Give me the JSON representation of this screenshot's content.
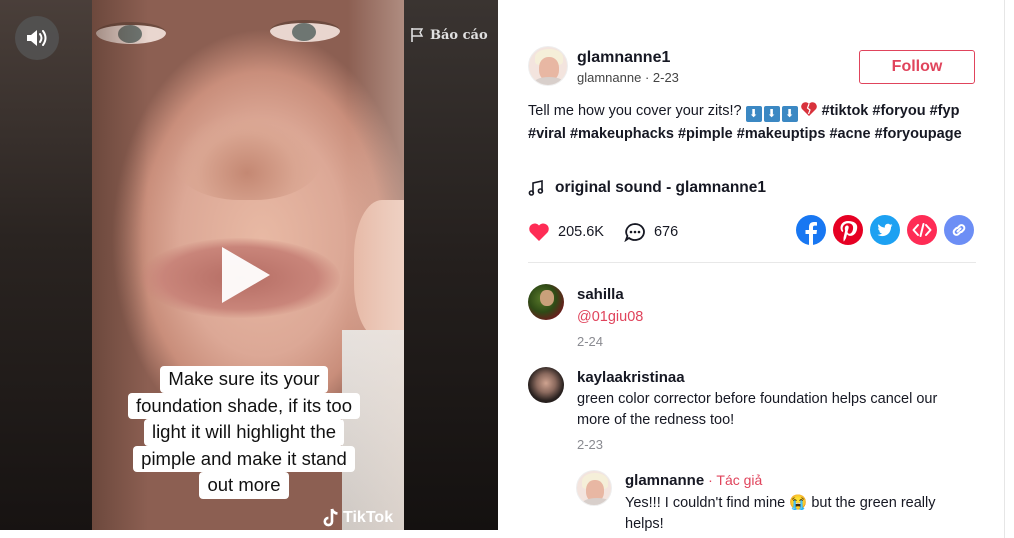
{
  "video": {
    "caption_lines": [
      "Make sure its your",
      "foundation shade, if its too",
      "light it will highlight the",
      "pimple and make it stand",
      "out more"
    ],
    "report_label": "Báo cáo",
    "watermark": "TikTok",
    "icons": {
      "sound": "speaker-icon",
      "report": "flag-icon",
      "play": "play-icon",
      "watermark": "tiktok-logo-icon"
    }
  },
  "author": {
    "username": "glamnanne1",
    "nickname": "glamnanne",
    "separator": " · ",
    "date": "2-23",
    "follow_label": "Follow"
  },
  "description": {
    "text": "Tell me how you cover your zits!? ",
    "emojis": [
      "⬇",
      "⬇",
      "⬇"
    ],
    "hashtags": [
      "#tiktok",
      "#foryou",
      "#fyp",
      "#viral",
      "#makeuphacks",
      "#pimple",
      "#makeuptips",
      "#acne",
      "#foryoupage"
    ]
  },
  "sound": {
    "label": "original sound - glamnanne1"
  },
  "stats": {
    "likes": "205.6K",
    "comments": "676"
  },
  "share": {
    "items": [
      {
        "name": "facebook-share-icon",
        "color": "#1877f2"
      },
      {
        "name": "pinterest-share-icon",
        "color": "#e60023"
      },
      {
        "name": "twitter-share-icon",
        "color": "#1da1f2"
      },
      {
        "name": "embed-share-icon",
        "color": "#fe2c55"
      },
      {
        "name": "copy-link-icon",
        "color": "#6c8ef5"
      }
    ]
  },
  "comments": [
    {
      "username": "sahilla",
      "text": "@01giu08",
      "date": "2-24"
    },
    {
      "username": "kaylaakristinaa",
      "text": "green color corrector before foundation helps cancel our more of the redness too!",
      "date": "2-23"
    }
  ],
  "reply": {
    "username": "glamnanne",
    "separator": " · ",
    "author_tag": "Tác giả",
    "text_before": "Yes!!! I couldn't find mine ",
    "emoji": "😭",
    "text_after": " but the green really helps!"
  },
  "colors": {
    "accent": "#e0445c",
    "like": "#fe2c55",
    "text": "#161823",
    "muted": "#8a8b91"
  }
}
